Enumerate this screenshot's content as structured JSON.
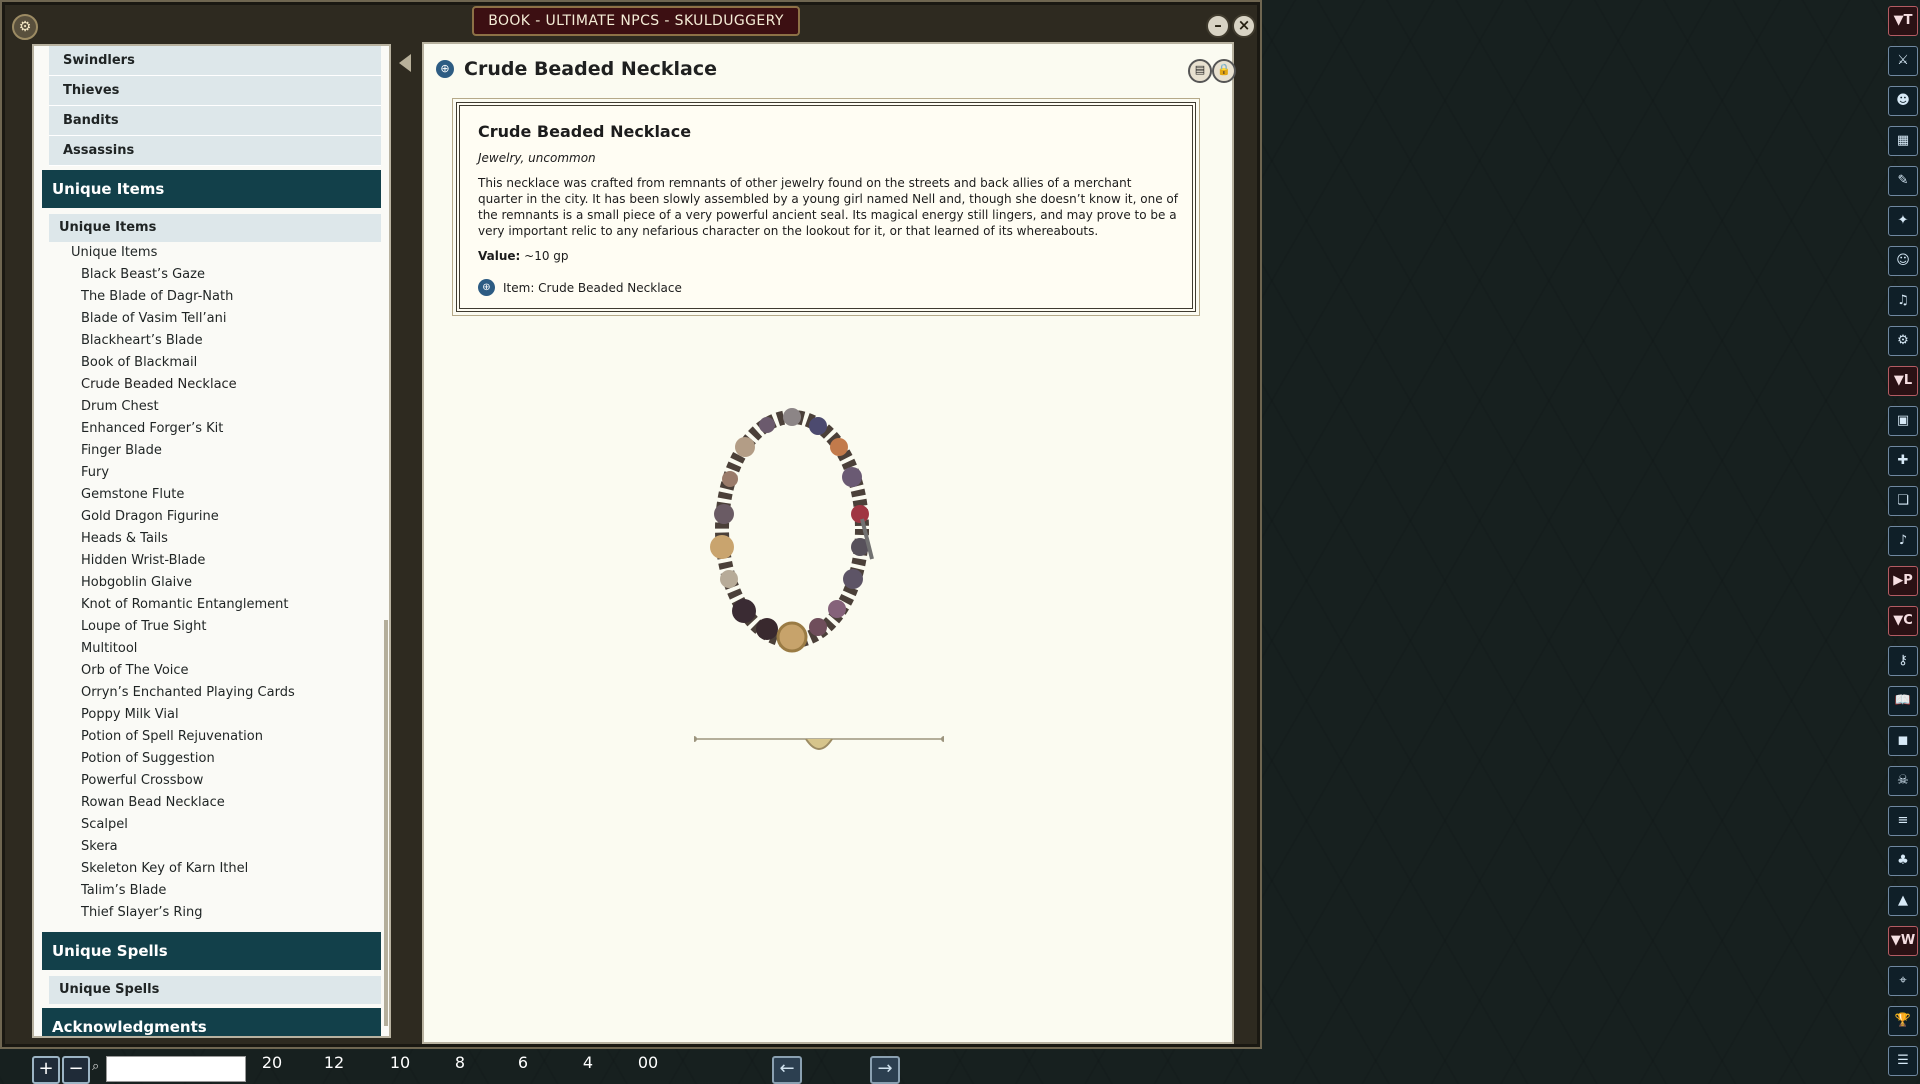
{
  "window": {
    "title": "BOOK - ULTIMATE NPCS - SKULDUGGERY"
  },
  "sidebar": {
    "top_items": [
      "Swindlers",
      "Thieves",
      "Bandits",
      "Assassins"
    ],
    "sections": [
      {
        "title": "Unique Items",
        "group": "Unique Items",
        "list_head": "Unique Items",
        "items": [
          "Black Beast’s Gaze",
          "The Blade of Dagr-Nath",
          "Blade of Vasim Tell’ani",
          "Blackheart’s Blade",
          "Book of Blackmail",
          "Crude Beaded Necklace",
          "Drum Chest",
          "Enhanced Forger’s Kit",
          "Finger Blade",
          "Fury",
          "Gemstone Flute",
          "Gold Dragon Figurine",
          "Heads & Tails",
          "Hidden Wrist-Blade",
          "Hobgoblin Glaive",
          "Knot of Romantic Entanglement",
          "Loupe of True Sight",
          "Multitool",
          "Orb of The Voice",
          "Orryn’s Enchanted Playing Cards",
          "Poppy Milk Vial",
          "Potion of Spell Rejuvenation",
          "Potion of Suggestion",
          "Powerful Crossbow",
          "Rowan Bead Necklace",
          "Scalpel",
          "Skera",
          "Skeleton Key of Karn Ithel",
          "Talim’s Blade",
          "Thief Slayer’s Ring"
        ]
      },
      {
        "title": "Unique Spells",
        "group": "Unique Spells"
      },
      {
        "title": "Acknowledgments"
      }
    ]
  },
  "content": {
    "title": "Crude Beaded Necklace",
    "card": {
      "title": "Crude Beaded Necklace",
      "meta": "Jewelry, uncommon",
      "description": "This necklace was crafted from remnants of other jewelry found on the streets and back allies of a merchant quarter in the city. It has been slowly assembled by a young girl named Nell and, though she doesn’t know it, one of the remnants is a small piece of a very powerful ancient seal. Its magical energy still lingers, and may prove to be a very important relic to any nefarious character on the lookout for it, or that learned of its whereabouts.",
      "value_label": "Value:",
      "value": "~10 gp",
      "link": "Item: Crude Beaded Necklace"
    }
  },
  "bottom": {
    "dice": [
      "20",
      "12",
      "10",
      "8",
      "6",
      "4",
      "00"
    ]
  },
  "right_bar": {
    "categories": [
      "T",
      "L",
      "P",
      "C",
      "W"
    ]
  }
}
